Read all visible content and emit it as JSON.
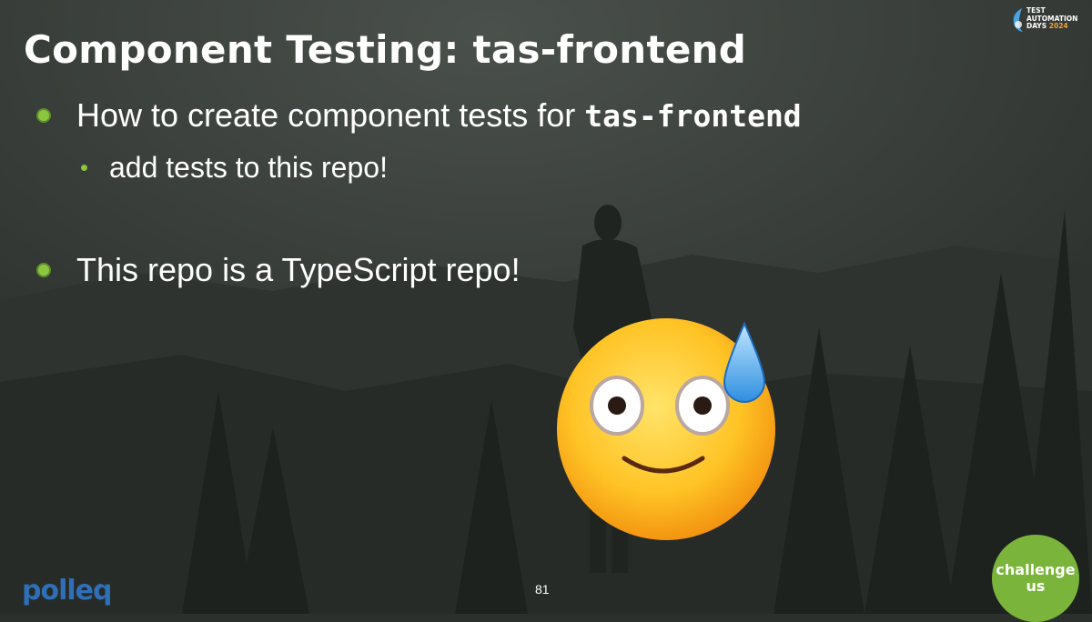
{
  "slide": {
    "title": "Component Testing: tas-frontend",
    "bullets": [
      {
        "text": "How to create component tests for ",
        "code": "tas-frontend"
      },
      {
        "text": "add tests to this repo!"
      },
      {
        "text": "This repo is a TypeScript repo!"
      }
    ],
    "page_number": "81"
  },
  "branding": {
    "event_logo_lines": [
      "TEST",
      "AUTOMATION",
      "DAYS"
    ],
    "event_year": "2024",
    "company_logo": "polleq",
    "badge_lines": [
      "challenge",
      "us"
    ]
  },
  "decorations": {
    "emoji": "sweat-smile-face-icon",
    "background": "dark-mountain-forest-hiker-photo"
  },
  "colors": {
    "bullet_green": "#8cc63f",
    "title_text": "#ffffff",
    "badge_green": "#7ab43a",
    "polleq_blue": "#2f6fb8"
  }
}
